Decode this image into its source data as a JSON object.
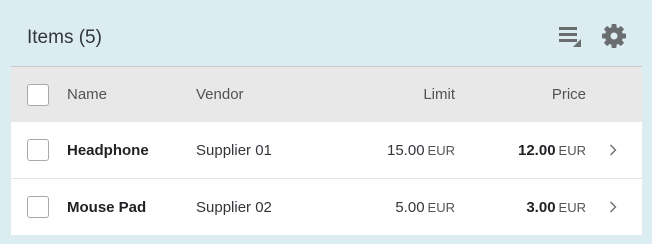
{
  "toolbar": {
    "title": "Items (5)",
    "sort_icon": "sort-settings-icon",
    "settings_icon": "gear-icon"
  },
  "table": {
    "columns": {
      "name": "Name",
      "vendor": "Vendor",
      "limit": "Limit",
      "price": "Price"
    },
    "rows": [
      {
        "name": "Headphone",
        "vendor": "Supplier 01",
        "limit": "15.00",
        "limit_unit": "EUR",
        "price": "12.00",
        "price_unit": "EUR"
      },
      {
        "name": "Mouse Pad",
        "vendor": "Supplier 02",
        "limit": "5.00",
        "limit_unit": "EUR",
        "price": "3.00",
        "price_unit": "EUR"
      }
    ]
  },
  "colors": {
    "background": "#dcedf2",
    "header_bg": "#e8e8e8",
    "icon": "#6a6d70"
  }
}
